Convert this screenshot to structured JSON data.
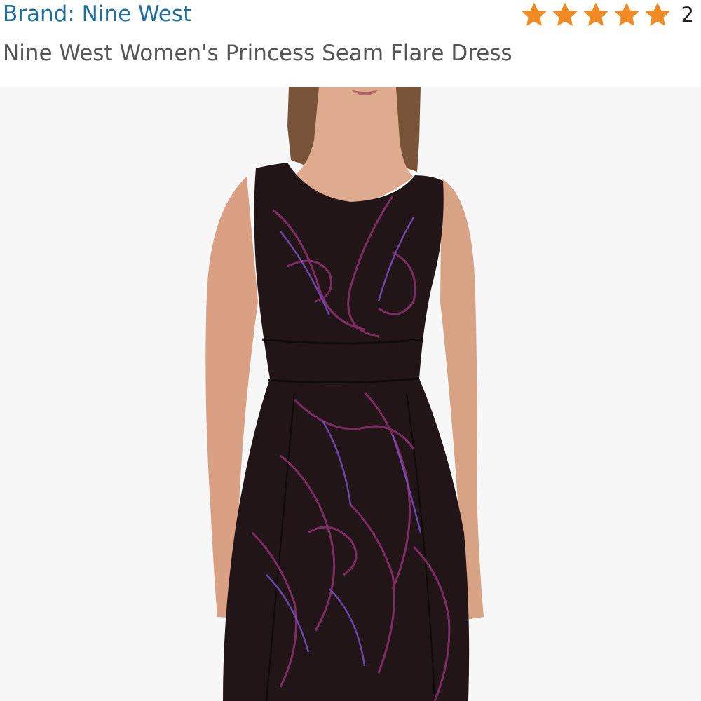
{
  "brand": {
    "label": "Brand: Nine West"
  },
  "rating": {
    "value": 5,
    "max": 5,
    "count": "2",
    "star_color": "#f08a24",
    "icon": "star-icon"
  },
  "product": {
    "title": "Nine West Women's Princess Seam Flare Dress"
  },
  "image": {
    "background": "#f7f7f7",
    "dress_color": "#211517",
    "pattern_colors": [
      "#8b2f6d",
      "#7a4fc4"
    ],
    "skin_color": "#d9a083",
    "hair_color": "#7a5438"
  }
}
